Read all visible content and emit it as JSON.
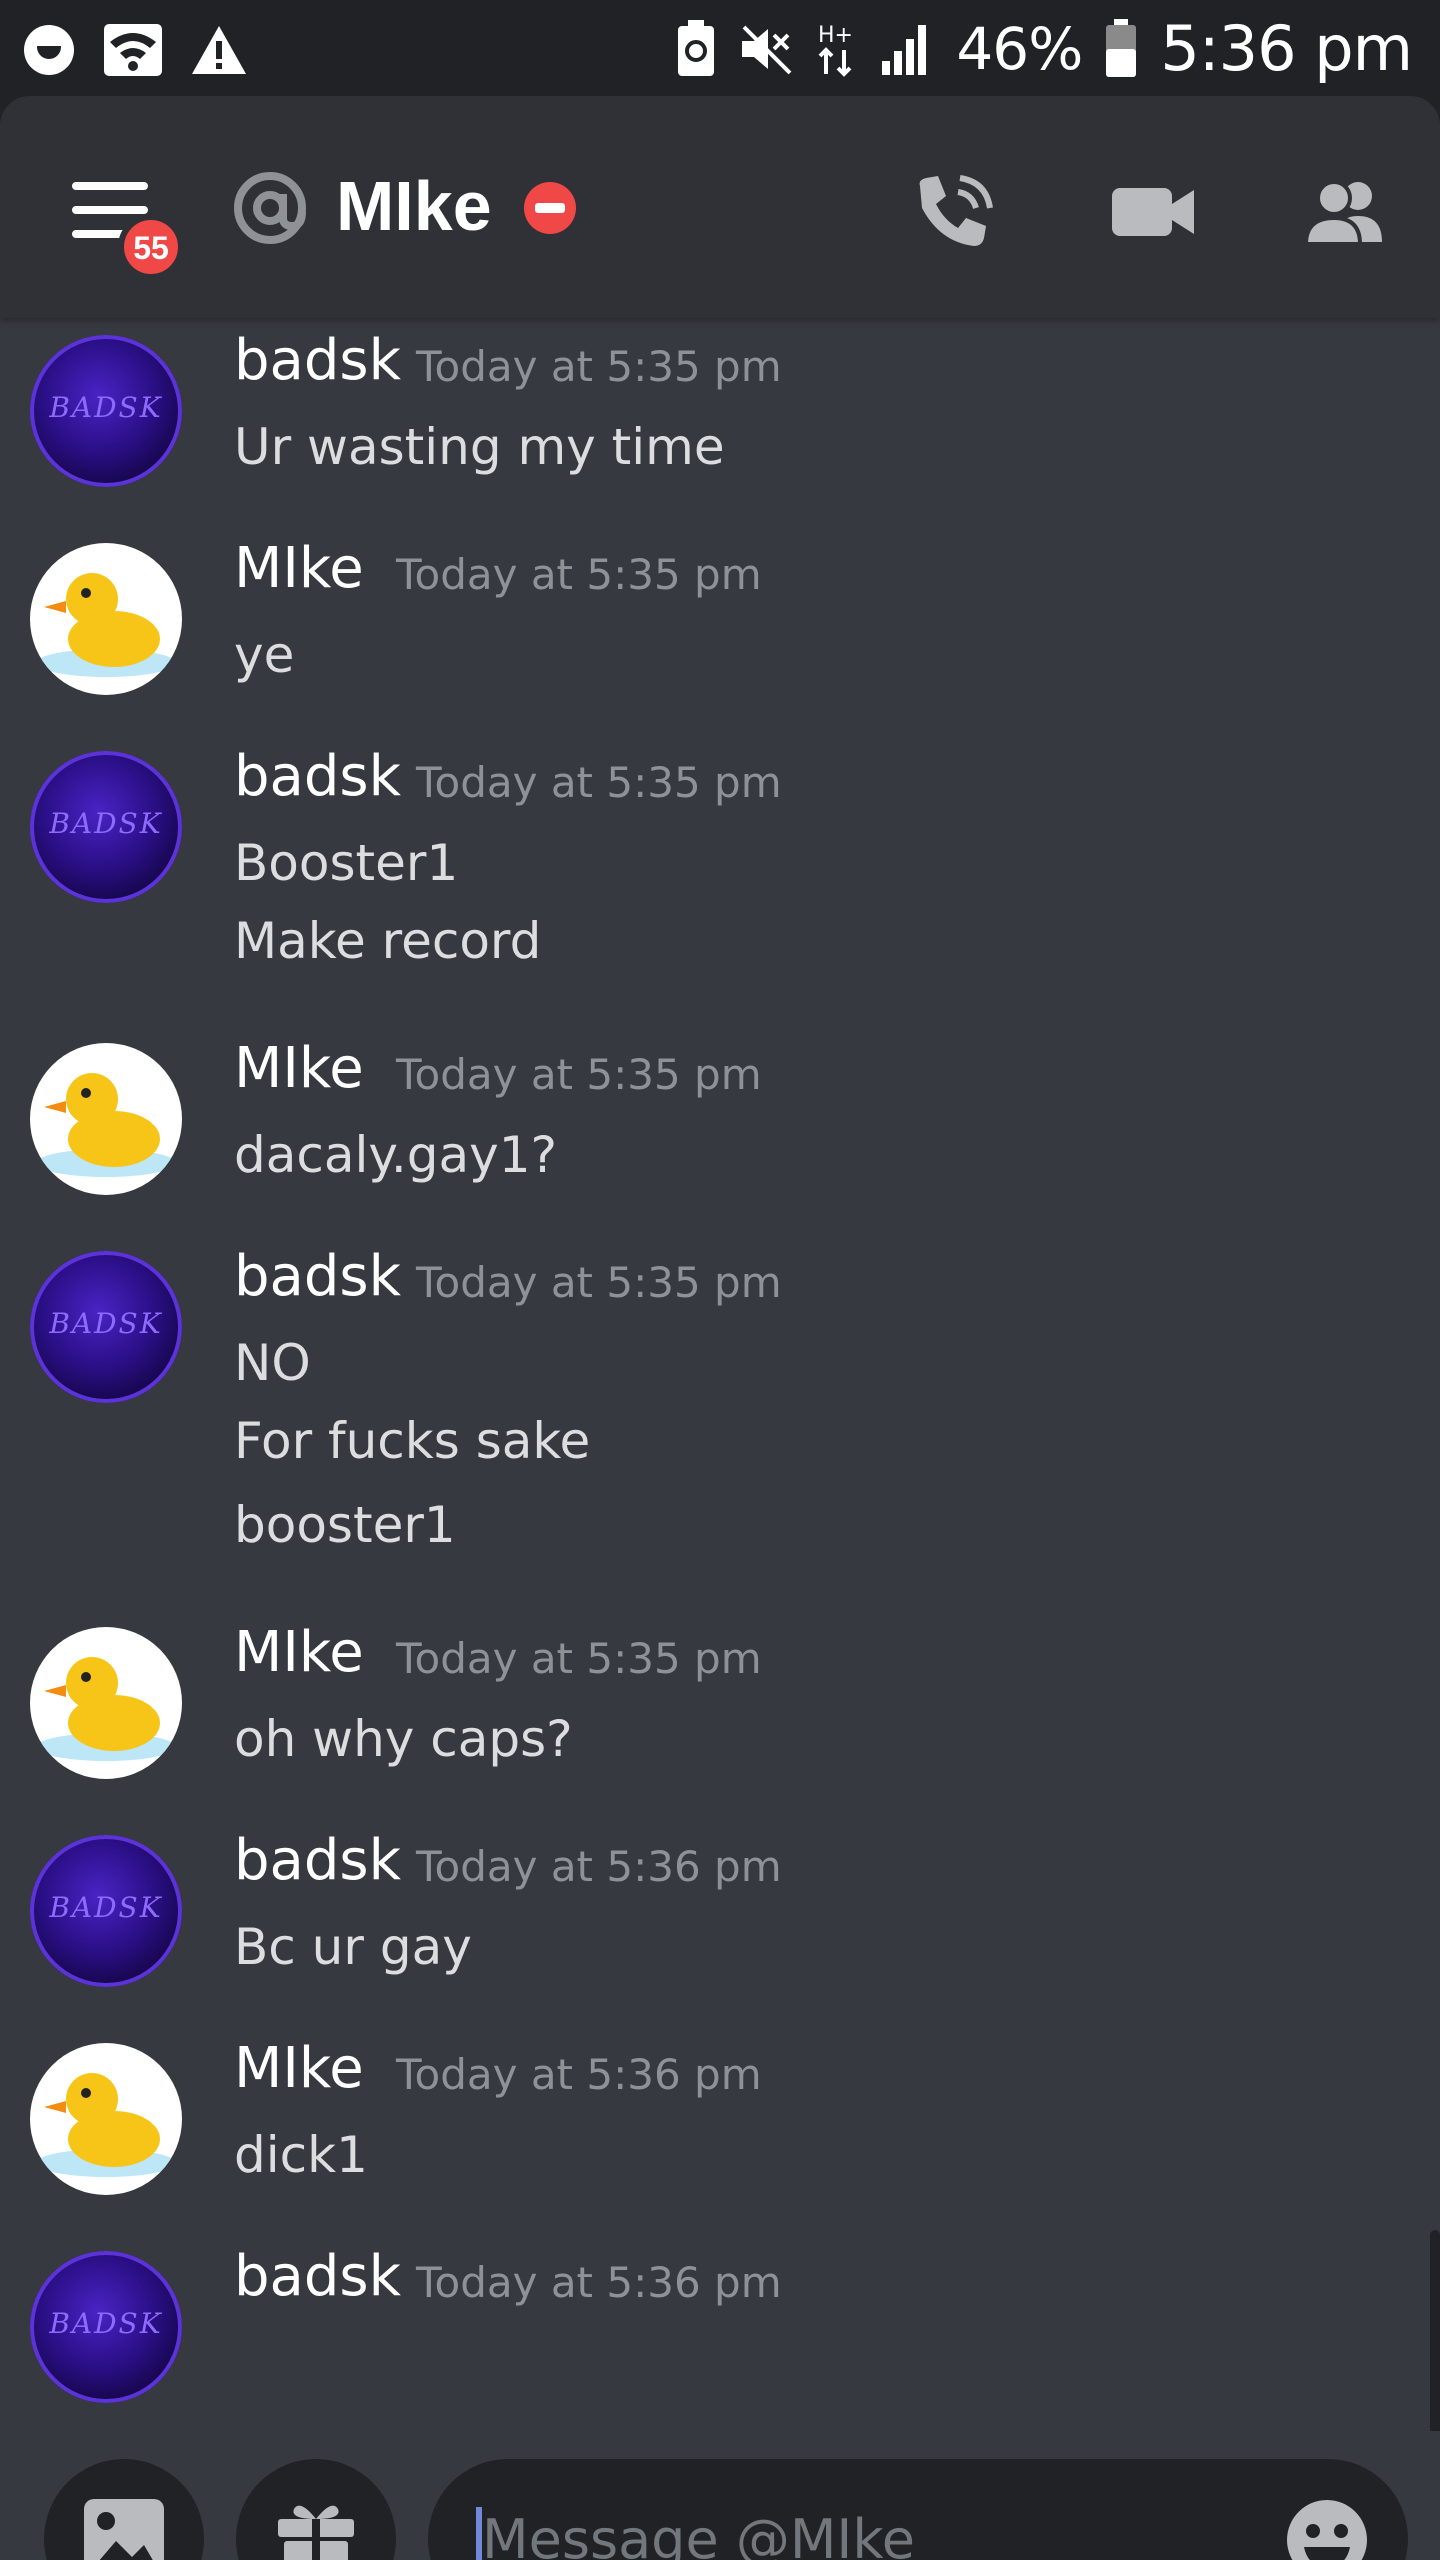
{
  "status_bar": {
    "battery_percent": "46%",
    "time": "5:36 pm",
    "icons": [
      "face-icon",
      "wifi-icon",
      "alert-icon",
      "battery-saver-icon",
      "mute-icon",
      "data-transfer-icon",
      "signal-icon",
      "battery-icon"
    ]
  },
  "header": {
    "unread_badge": "55",
    "channel_name": "MIke",
    "status": "do-not-disturb",
    "icons": [
      "menu-icon",
      "at-icon",
      "call-icon",
      "video-icon",
      "members-icon"
    ]
  },
  "messages": [
    {
      "author": "badsk",
      "timestamp": "Today at 5:35 pm",
      "avatar": "badsk",
      "avatar_text": "BADSK",
      "lines": [
        "Ur wasting my time"
      ]
    },
    {
      "author": "MIke",
      "timestamp": "Today at 5:35 pm",
      "avatar": "duck",
      "lines": [
        "ye"
      ]
    },
    {
      "author": "badsk",
      "timestamp": "Today at 5:35 pm",
      "avatar": "badsk",
      "avatar_text": "BADSK",
      "lines": [
        "Booster1",
        "Make record"
      ]
    },
    {
      "author": "MIke",
      "timestamp": "Today at 5:35 pm",
      "avatar": "duck",
      "lines": [
        "dacaly.gay1?"
      ]
    },
    {
      "author": "badsk",
      "timestamp": "Today at 5:35 pm",
      "avatar": "badsk",
      "avatar_text": "BADSK",
      "lines": [
        "NO",
        "For fucks sake",
        "booster1"
      ]
    },
    {
      "author": "MIke",
      "timestamp": "Today at 5:35 pm",
      "avatar": "duck",
      "lines": [
        "oh why caps?"
      ]
    },
    {
      "author": "badsk",
      "timestamp": "Today at 5:36 pm",
      "avatar": "badsk",
      "avatar_text": "BADSK",
      "lines": [
        "Bc ur gay"
      ]
    },
    {
      "author": "MIke",
      "timestamp": "Today at 5:36 pm",
      "avatar": "duck",
      "lines": [
        "dick1"
      ]
    },
    {
      "author": "badsk",
      "timestamp": "Today at 5:36 pm",
      "avatar": "badsk",
      "avatar_text": "BADSK",
      "lines": []
    }
  ],
  "composer": {
    "placeholder": "Message @MIke",
    "icons": [
      "image-icon",
      "gift-icon",
      "emoji-icon"
    ]
  },
  "colors": {
    "background": "#36393f",
    "header": "#2f3136",
    "status_bar": "#202225",
    "badge_red": "#f04747",
    "text_primary": "#ffffff",
    "text_message": "#dcddde",
    "text_muted": "#8e9297",
    "caret_blurple": "#7289da"
  }
}
